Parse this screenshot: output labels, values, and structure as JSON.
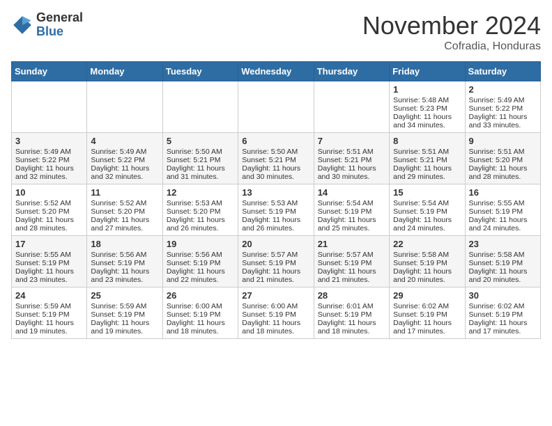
{
  "header": {
    "logo_general": "General",
    "logo_blue": "Blue",
    "month_title": "November 2024",
    "location": "Cofradia, Honduras"
  },
  "weekdays": [
    "Sunday",
    "Monday",
    "Tuesday",
    "Wednesday",
    "Thursday",
    "Friday",
    "Saturday"
  ],
  "weeks": [
    [
      {
        "day": "",
        "sunrise": "",
        "sunset": "",
        "daylight": ""
      },
      {
        "day": "",
        "sunrise": "",
        "sunset": "",
        "daylight": ""
      },
      {
        "day": "",
        "sunrise": "",
        "sunset": "",
        "daylight": ""
      },
      {
        "day": "",
        "sunrise": "",
        "sunset": "",
        "daylight": ""
      },
      {
        "day": "",
        "sunrise": "",
        "sunset": "",
        "daylight": ""
      },
      {
        "day": "1",
        "sunrise": "Sunrise: 5:48 AM",
        "sunset": "Sunset: 5:23 PM",
        "daylight": "Daylight: 11 hours and 34 minutes."
      },
      {
        "day": "2",
        "sunrise": "Sunrise: 5:49 AM",
        "sunset": "Sunset: 5:22 PM",
        "daylight": "Daylight: 11 hours and 33 minutes."
      }
    ],
    [
      {
        "day": "3",
        "sunrise": "Sunrise: 5:49 AM",
        "sunset": "Sunset: 5:22 PM",
        "daylight": "Daylight: 11 hours and 32 minutes."
      },
      {
        "day": "4",
        "sunrise": "Sunrise: 5:49 AM",
        "sunset": "Sunset: 5:22 PM",
        "daylight": "Daylight: 11 hours and 32 minutes."
      },
      {
        "day": "5",
        "sunrise": "Sunrise: 5:50 AM",
        "sunset": "Sunset: 5:21 PM",
        "daylight": "Daylight: 11 hours and 31 minutes."
      },
      {
        "day": "6",
        "sunrise": "Sunrise: 5:50 AM",
        "sunset": "Sunset: 5:21 PM",
        "daylight": "Daylight: 11 hours and 30 minutes."
      },
      {
        "day": "7",
        "sunrise": "Sunrise: 5:51 AM",
        "sunset": "Sunset: 5:21 PM",
        "daylight": "Daylight: 11 hours and 30 minutes."
      },
      {
        "day": "8",
        "sunrise": "Sunrise: 5:51 AM",
        "sunset": "Sunset: 5:21 PM",
        "daylight": "Daylight: 11 hours and 29 minutes."
      },
      {
        "day": "9",
        "sunrise": "Sunrise: 5:51 AM",
        "sunset": "Sunset: 5:20 PM",
        "daylight": "Daylight: 11 hours and 28 minutes."
      }
    ],
    [
      {
        "day": "10",
        "sunrise": "Sunrise: 5:52 AM",
        "sunset": "Sunset: 5:20 PM",
        "daylight": "Daylight: 11 hours and 28 minutes."
      },
      {
        "day": "11",
        "sunrise": "Sunrise: 5:52 AM",
        "sunset": "Sunset: 5:20 PM",
        "daylight": "Daylight: 11 hours and 27 minutes."
      },
      {
        "day": "12",
        "sunrise": "Sunrise: 5:53 AM",
        "sunset": "Sunset: 5:20 PM",
        "daylight": "Daylight: 11 hours and 26 minutes."
      },
      {
        "day": "13",
        "sunrise": "Sunrise: 5:53 AM",
        "sunset": "Sunset: 5:19 PM",
        "daylight": "Daylight: 11 hours and 26 minutes."
      },
      {
        "day": "14",
        "sunrise": "Sunrise: 5:54 AM",
        "sunset": "Sunset: 5:19 PM",
        "daylight": "Daylight: 11 hours and 25 minutes."
      },
      {
        "day": "15",
        "sunrise": "Sunrise: 5:54 AM",
        "sunset": "Sunset: 5:19 PM",
        "daylight": "Daylight: 11 hours and 24 minutes."
      },
      {
        "day": "16",
        "sunrise": "Sunrise: 5:55 AM",
        "sunset": "Sunset: 5:19 PM",
        "daylight": "Daylight: 11 hours and 24 minutes."
      }
    ],
    [
      {
        "day": "17",
        "sunrise": "Sunrise: 5:55 AM",
        "sunset": "Sunset: 5:19 PM",
        "daylight": "Daylight: 11 hours and 23 minutes."
      },
      {
        "day": "18",
        "sunrise": "Sunrise: 5:56 AM",
        "sunset": "Sunset: 5:19 PM",
        "daylight": "Daylight: 11 hours and 23 minutes."
      },
      {
        "day": "19",
        "sunrise": "Sunrise: 5:56 AM",
        "sunset": "Sunset: 5:19 PM",
        "daylight": "Daylight: 11 hours and 22 minutes."
      },
      {
        "day": "20",
        "sunrise": "Sunrise: 5:57 AM",
        "sunset": "Sunset: 5:19 PM",
        "daylight": "Daylight: 11 hours and 21 minutes."
      },
      {
        "day": "21",
        "sunrise": "Sunrise: 5:57 AM",
        "sunset": "Sunset: 5:19 PM",
        "daylight": "Daylight: 11 hours and 21 minutes."
      },
      {
        "day": "22",
        "sunrise": "Sunrise: 5:58 AM",
        "sunset": "Sunset: 5:19 PM",
        "daylight": "Daylight: 11 hours and 20 minutes."
      },
      {
        "day": "23",
        "sunrise": "Sunrise: 5:58 AM",
        "sunset": "Sunset: 5:19 PM",
        "daylight": "Daylight: 11 hours and 20 minutes."
      }
    ],
    [
      {
        "day": "24",
        "sunrise": "Sunrise: 5:59 AM",
        "sunset": "Sunset: 5:19 PM",
        "daylight": "Daylight: 11 hours and 19 minutes."
      },
      {
        "day": "25",
        "sunrise": "Sunrise: 5:59 AM",
        "sunset": "Sunset: 5:19 PM",
        "daylight": "Daylight: 11 hours and 19 minutes."
      },
      {
        "day": "26",
        "sunrise": "Sunrise: 6:00 AM",
        "sunset": "Sunset: 5:19 PM",
        "daylight": "Daylight: 11 hours and 18 minutes."
      },
      {
        "day": "27",
        "sunrise": "Sunrise: 6:00 AM",
        "sunset": "Sunset: 5:19 PM",
        "daylight": "Daylight: 11 hours and 18 minutes."
      },
      {
        "day": "28",
        "sunrise": "Sunrise: 6:01 AM",
        "sunset": "Sunset: 5:19 PM",
        "daylight": "Daylight: 11 hours and 18 minutes."
      },
      {
        "day": "29",
        "sunrise": "Sunrise: 6:02 AM",
        "sunset": "Sunset: 5:19 PM",
        "daylight": "Daylight: 11 hours and 17 minutes."
      },
      {
        "day": "30",
        "sunrise": "Sunrise: 6:02 AM",
        "sunset": "Sunset: 5:19 PM",
        "daylight": "Daylight: 11 hours and 17 minutes."
      }
    ]
  ]
}
